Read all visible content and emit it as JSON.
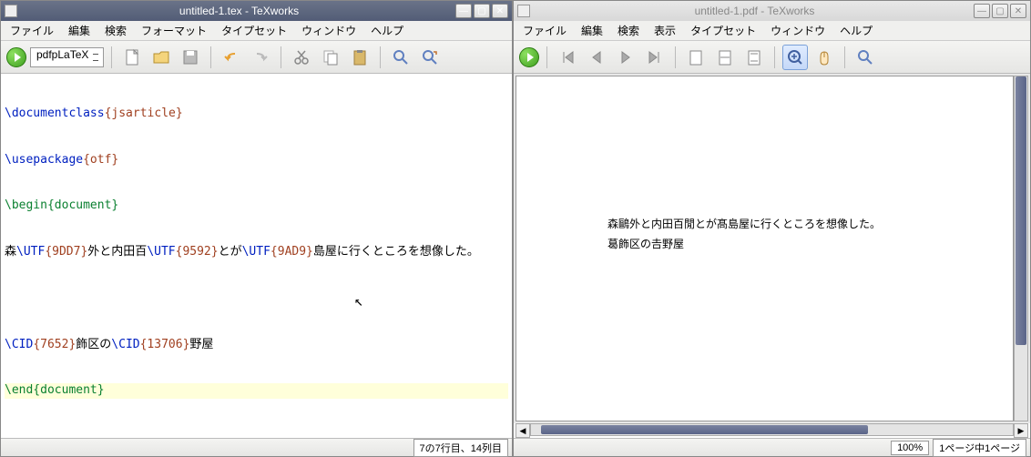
{
  "left": {
    "title": "untitled-1.tex - TeXworks",
    "menus": [
      "ファイル",
      "編集",
      "検索",
      "フォーマット",
      "タイプセット",
      "ウィンドウ",
      "ヘルプ"
    ],
    "engine": "pdfpLaTeX",
    "code": {
      "l1_cmd": "\\documentclass",
      "l1_arg": "{jsarticle}",
      "l2_cmd": "\\usepackage",
      "l2_arg": "{otf}",
      "l3_env": "\\begin{document}",
      "l4_a": "森",
      "l4_cmd1": "\\UTF",
      "l4_arg1": "{9DD7}",
      "l4_b": "外と内田百",
      "l4_cmd2": "\\UTF",
      "l4_arg2": "{9592}",
      "l4_c": "とが",
      "l4_cmd3": "\\UTF",
      "l4_arg3": "{9AD9}",
      "l4_d": "島屋に行くところを想像した。",
      "l6_cmd1": "\\CID",
      "l6_arg1": "{7652}",
      "l6_a": "飾区の",
      "l6_cmd2": "\\CID",
      "l6_arg2": "{13706}",
      "l6_b": "野屋",
      "l7_env": "\\end{document}"
    },
    "status": "7の7行目、14列目"
  },
  "right": {
    "title": "untitled-1.pdf - TeXworks",
    "menus": [
      "ファイル",
      "編集",
      "検索",
      "表示",
      "タイプセット",
      "ウィンドウ",
      "ヘルプ"
    ],
    "page_text1": "森鷗外と内田百閒とが髙島屋に行くところを想像した。",
    "page_text2": "葛飾区の𠮷野屋",
    "zoom": "100%",
    "pages": "1ページ中1ページ"
  }
}
